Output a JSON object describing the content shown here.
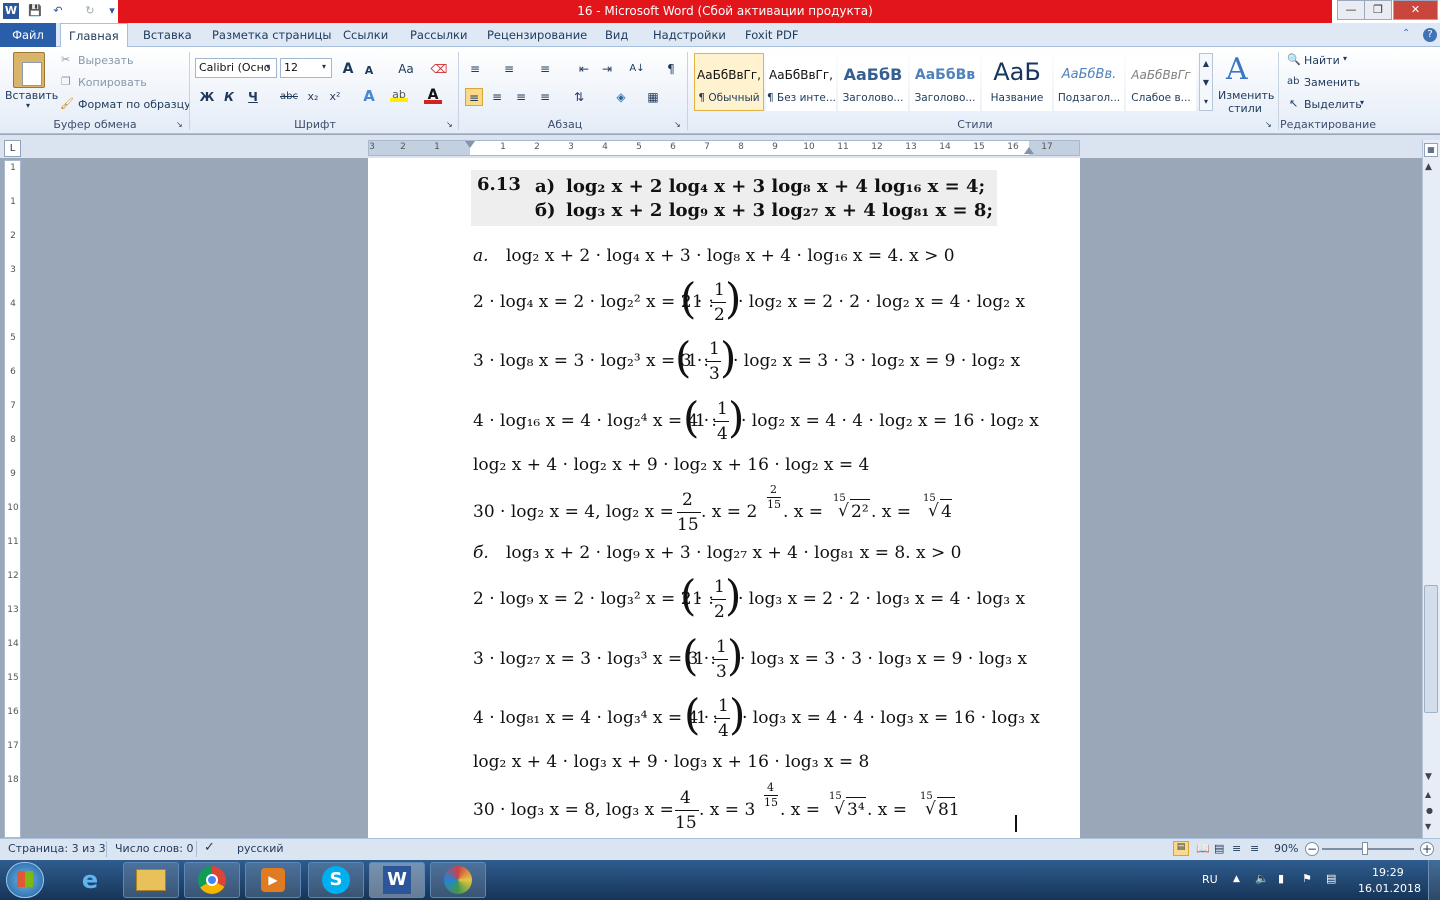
{
  "window": {
    "title": "16 - Microsoft Word (Сбой активации продукта)"
  },
  "quick_access": [
    "save-icon",
    "undo-icon",
    "redo-icon",
    "customize-icon"
  ],
  "tabs": [
    "Файл",
    "Главная",
    "Вставка",
    "Разметка страницы",
    "Ссылки",
    "Рассылки",
    "Рецензирование",
    "Вид",
    "Надстройки",
    "Foxit PDF"
  ],
  "clipboard": {
    "paste": "Вставить",
    "cut": "Вырезать",
    "copy": "Копировать",
    "format_painter": "Формат по образцу",
    "group": "Буфер обмена"
  },
  "font": {
    "name": "Calibri (Осно",
    "size": "12",
    "group": "Шрифт",
    "bold": "Ж",
    "italic": "К",
    "underline": "Ч",
    "strike": "abc",
    "sub": "x₂",
    "sup": "x²",
    "grow": "A",
    "shrink": "A",
    "case": "Aa"
  },
  "paragraph": {
    "group": "Абзац"
  },
  "styles": {
    "group": "Стили",
    "items": [
      {
        "sample": "АаБбВвГг,",
        "name": "¶ Обычный"
      },
      {
        "sample": "АаБбВвГг,",
        "name": "¶ Без инте..."
      },
      {
        "sample": "АаБбВ",
        "name": "Заголово..."
      },
      {
        "sample": "АаБбВв",
        "name": "Заголово..."
      },
      {
        "sample": "АаБ",
        "name": "Название"
      },
      {
        "sample": "АаБбВв.",
        "name": "Подзагол..."
      },
      {
        "sample": "АаБбВвГг",
        "name": "Слабое в..."
      }
    ],
    "change": "Изменить стили"
  },
  "editing": {
    "find": "Найти",
    "replace": "Заменить",
    "select": "Выделить",
    "group": "Редактирование"
  },
  "ruler": {
    "h": [
      "3",
      "2",
      "1",
      "",
      "1",
      "2",
      "3",
      "4",
      "5",
      "6",
      "7",
      "8",
      "9",
      "10",
      "11",
      "12",
      "13",
      "14",
      "15",
      "16",
      "17"
    ],
    "v": [
      "1",
      "",
      "1",
      "2",
      "3",
      "4",
      "5",
      "6",
      "7",
      "8",
      "9",
      "10",
      "11",
      "12",
      "13",
      "14",
      "15",
      "16",
      "17",
      "18",
      "19"
    ]
  },
  "problem": {
    "num": "6.13",
    "a": "а)",
    "eq_a": "log₂ x + 2 log₄ x + 3 log₈ x + 4 log₁₆ x = 4;",
    "b": "б)",
    "eq_b": "log₃ x + 2 log₉ x + 3 log₂₇ x + 4 log₈₁ x = 8;"
  },
  "solution": {
    "a_head": "а.",
    "a_eq": "log₂ x + 2 · log₄ x + 3 · log₈ x + 4 · log₁₆ x = 4.     x > 0",
    "a1_l": "2 · log₄ x = 2 · log₂² x = 2 ·",
    "a1_in": "1 :",
    "a1_n": "1",
    "a1_d": "2",
    "a1_r": "· log₂ x = 2 · 2 · log₂ x = 4 · log₂ x",
    "a2_l": "3 · log₈ x = 3 · log₂³ x = 3 ·",
    "a2_in": "1 :",
    "a2_n": "1",
    "a2_d": "3",
    "a2_r": "· log₂ x = 3 · 3 · log₂ x = 9 · log₂ x",
    "a3_l": "4 · log₁₆ x = 4 · log₂⁴ x = 4 ·",
    "a3_in": "1 :",
    "a3_n": "1",
    "a3_d": "4",
    "a3_r": "· log₂ x = 4 · 4 · log₂ x = 16 · log₂ x",
    "a_sum": "log₂ x + 4 · log₂ x + 9 · log₂ x + 16 · log₂ x = 4",
    "a_res_l": "30 · log₂ x = 4,    log₂ x =",
    "a_res_n": "2",
    "a_res_d": "15",
    "a_res_r": ".     x = 2",
    "a_res_exp_n": "2",
    "a_res_exp_d": "15",
    "a_res_r2": ".     x =",
    "a_root1_idx": "15",
    "a_root1": "2²",
    "a_res_r3": ".     x =",
    "a_root2_idx": "15",
    "a_root2": "4",
    "b_head": "б.",
    "b_eq": "log₃ x + 2 · log₉ x + 3 · log₂₇ x + 4 · log₈₁ x = 8.     x > 0",
    "b1_l": "2 · log₉ x = 2 · log₃² x = 2 ·",
    "b1_in": "1 :",
    "b1_n": "1",
    "b1_d": "2",
    "b1_r": "· log₃ x = 2 · 2 · log₃ x = 4 · log₃ x",
    "b2_l": "3 · log₂₇ x = 3 · log₃³ x = 3 ·",
    "b2_in": "1 :",
    "b2_n": "1",
    "b2_d": "3",
    "b2_r": "· log₃ x = 3 · 3 · log₃ x = 9 · log₃ x",
    "b3_l": "4 · log₈₁ x = 4 · log₃⁴ x = 4 ·",
    "b3_in": "1 :",
    "b3_n": "1",
    "b3_d": "4",
    "b3_r": "· log₃ x = 4 · 4 · log₃ x = 16 · log₃ x",
    "b_sum": "log₂ x + 4 · log₃ x + 9 · log₃ x + 16 · log₃ x = 8",
    "b_res_l": "30 · log₃ x = 8,    log₃ x =",
    "b_res_n": "4",
    "b_res_d": "15",
    "b_res_r": ".     x = 3",
    "b_res_exp_n": "4",
    "b_res_exp_d": "15",
    "b_res_r2": ".     x =",
    "b_root1_idx": "15",
    "b_root1": "3⁴",
    "b_res_r3": ".     x =",
    "b_root2_idx": "15",
    "b_root2": "81"
  },
  "status": {
    "page": "Страница: 3 из 3",
    "words": "Число слов: 0",
    "lang": "русский",
    "zoom": "90%"
  },
  "taskbar": {
    "lang": "RU",
    "time": "19:29",
    "date": "16.01.2018"
  },
  "colors": {
    "title_red": "#e2151b",
    "file_tab": "#2a5ea8",
    "taskbar": "#1f4570"
  }
}
